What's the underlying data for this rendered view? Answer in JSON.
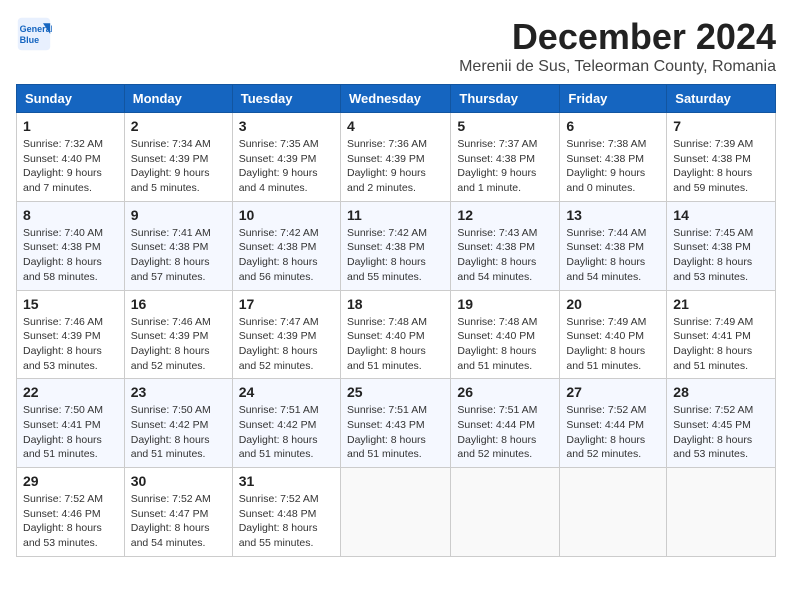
{
  "logo": {
    "line1": "General",
    "line2": "Blue"
  },
  "title": "December 2024",
  "subtitle": "Merenii de Sus, Teleorman County, Romania",
  "days_of_week": [
    "Sunday",
    "Monday",
    "Tuesday",
    "Wednesday",
    "Thursday",
    "Friday",
    "Saturday"
  ],
  "weeks": [
    [
      {
        "day": "1",
        "info": "Sunrise: 7:32 AM\nSunset: 4:40 PM\nDaylight: 9 hours and 7 minutes."
      },
      {
        "day": "2",
        "info": "Sunrise: 7:34 AM\nSunset: 4:39 PM\nDaylight: 9 hours and 5 minutes."
      },
      {
        "day": "3",
        "info": "Sunrise: 7:35 AM\nSunset: 4:39 PM\nDaylight: 9 hours and 4 minutes."
      },
      {
        "day": "4",
        "info": "Sunrise: 7:36 AM\nSunset: 4:39 PM\nDaylight: 9 hours and 2 minutes."
      },
      {
        "day": "5",
        "info": "Sunrise: 7:37 AM\nSunset: 4:38 PM\nDaylight: 9 hours and 1 minute."
      },
      {
        "day": "6",
        "info": "Sunrise: 7:38 AM\nSunset: 4:38 PM\nDaylight: 9 hours and 0 minutes."
      },
      {
        "day": "7",
        "info": "Sunrise: 7:39 AM\nSunset: 4:38 PM\nDaylight: 8 hours and 59 minutes."
      }
    ],
    [
      {
        "day": "8",
        "info": "Sunrise: 7:40 AM\nSunset: 4:38 PM\nDaylight: 8 hours and 58 minutes."
      },
      {
        "day": "9",
        "info": "Sunrise: 7:41 AM\nSunset: 4:38 PM\nDaylight: 8 hours and 57 minutes."
      },
      {
        "day": "10",
        "info": "Sunrise: 7:42 AM\nSunset: 4:38 PM\nDaylight: 8 hours and 56 minutes."
      },
      {
        "day": "11",
        "info": "Sunrise: 7:42 AM\nSunset: 4:38 PM\nDaylight: 8 hours and 55 minutes."
      },
      {
        "day": "12",
        "info": "Sunrise: 7:43 AM\nSunset: 4:38 PM\nDaylight: 8 hours and 54 minutes."
      },
      {
        "day": "13",
        "info": "Sunrise: 7:44 AM\nSunset: 4:38 PM\nDaylight: 8 hours and 54 minutes."
      },
      {
        "day": "14",
        "info": "Sunrise: 7:45 AM\nSunset: 4:38 PM\nDaylight: 8 hours and 53 minutes."
      }
    ],
    [
      {
        "day": "15",
        "info": "Sunrise: 7:46 AM\nSunset: 4:39 PM\nDaylight: 8 hours and 53 minutes."
      },
      {
        "day": "16",
        "info": "Sunrise: 7:46 AM\nSunset: 4:39 PM\nDaylight: 8 hours and 52 minutes."
      },
      {
        "day": "17",
        "info": "Sunrise: 7:47 AM\nSunset: 4:39 PM\nDaylight: 8 hours and 52 minutes."
      },
      {
        "day": "18",
        "info": "Sunrise: 7:48 AM\nSunset: 4:40 PM\nDaylight: 8 hours and 51 minutes."
      },
      {
        "day": "19",
        "info": "Sunrise: 7:48 AM\nSunset: 4:40 PM\nDaylight: 8 hours and 51 minutes."
      },
      {
        "day": "20",
        "info": "Sunrise: 7:49 AM\nSunset: 4:40 PM\nDaylight: 8 hours and 51 minutes."
      },
      {
        "day": "21",
        "info": "Sunrise: 7:49 AM\nSunset: 4:41 PM\nDaylight: 8 hours and 51 minutes."
      }
    ],
    [
      {
        "day": "22",
        "info": "Sunrise: 7:50 AM\nSunset: 4:41 PM\nDaylight: 8 hours and 51 minutes."
      },
      {
        "day": "23",
        "info": "Sunrise: 7:50 AM\nSunset: 4:42 PM\nDaylight: 8 hours and 51 minutes."
      },
      {
        "day": "24",
        "info": "Sunrise: 7:51 AM\nSunset: 4:42 PM\nDaylight: 8 hours and 51 minutes."
      },
      {
        "day": "25",
        "info": "Sunrise: 7:51 AM\nSunset: 4:43 PM\nDaylight: 8 hours and 51 minutes."
      },
      {
        "day": "26",
        "info": "Sunrise: 7:51 AM\nSunset: 4:44 PM\nDaylight: 8 hours and 52 minutes."
      },
      {
        "day": "27",
        "info": "Sunrise: 7:52 AM\nSunset: 4:44 PM\nDaylight: 8 hours and 52 minutes."
      },
      {
        "day": "28",
        "info": "Sunrise: 7:52 AM\nSunset: 4:45 PM\nDaylight: 8 hours and 53 minutes."
      }
    ],
    [
      {
        "day": "29",
        "info": "Sunrise: 7:52 AM\nSunset: 4:46 PM\nDaylight: 8 hours and 53 minutes."
      },
      {
        "day": "30",
        "info": "Sunrise: 7:52 AM\nSunset: 4:47 PM\nDaylight: 8 hours and 54 minutes."
      },
      {
        "day": "31",
        "info": "Sunrise: 7:52 AM\nSunset: 4:48 PM\nDaylight: 8 hours and 55 minutes."
      },
      null,
      null,
      null,
      null
    ]
  ]
}
